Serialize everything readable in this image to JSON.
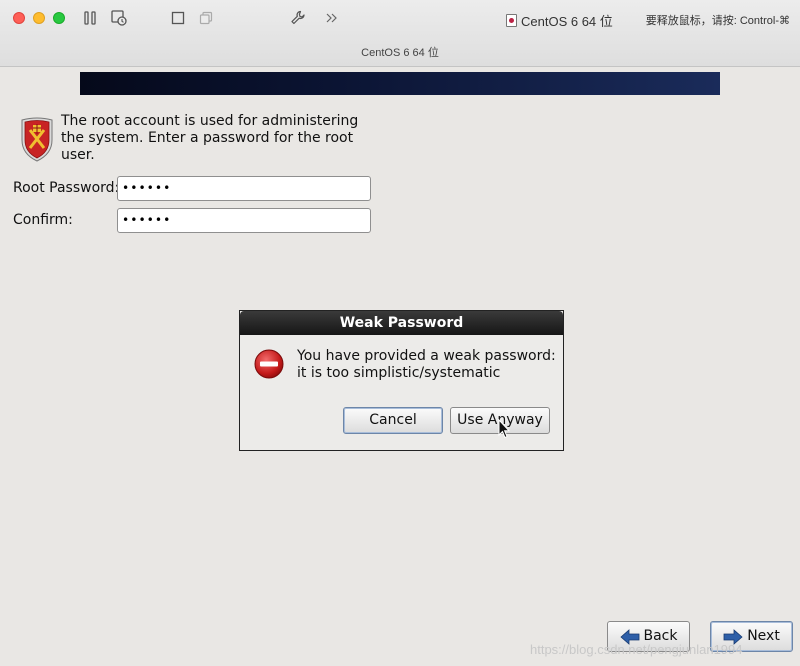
{
  "host": {
    "vm_name": "CentOS 6 64 位",
    "release_hint": "要释放鼠标，请按: Control-⌘",
    "window_title": "CentOS 6 64 位"
  },
  "installer": {
    "intro_text": "The root account is used for administering the system.  Enter a password for the root user.",
    "root_password_label": "Root Password:",
    "root_password_value": "••••••",
    "confirm_label": "Confirm:",
    "confirm_value": "••••••",
    "back_label": "Back",
    "next_label": "Next"
  },
  "dialog": {
    "title": "Weak Password",
    "message": "You have provided a weak password: it is too simplistic/systematic",
    "cancel_label": "Cancel",
    "use_anyway_label": "Use Anyway"
  },
  "watermark": "https://blog.csdn.net/pengjunlan1994",
  "colors": {
    "dialog_title_bg": "#1e1e1e",
    "error_red": "#c41a1a",
    "arrow_blue": "#2e5fa8",
    "banner": "#0b1433"
  }
}
